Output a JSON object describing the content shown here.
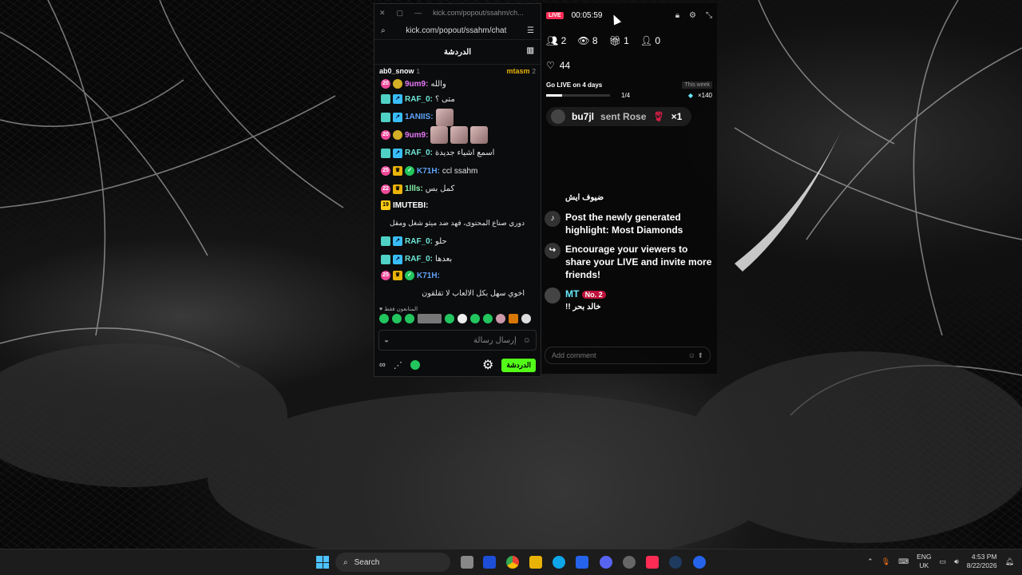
{
  "chat_window": {
    "url_title": "kick.com/popout/ssahm/ch...",
    "url": "kick.com/popout/ssahm/chat",
    "header": "الدردشة",
    "pinned": [
      {
        "name": "ab0_snow",
        "count": "1"
      },
      {
        "name": "mtasm",
        "count": "2"
      }
    ],
    "messages": [
      {
        "user": "9um9:",
        "text": "والله",
        "color": "pink"
      },
      {
        "user": "RAF_0:",
        "text": "متى ؟",
        "color": "teal"
      },
      {
        "user": "1ANIIS:",
        "text": "",
        "color": "blue"
      },
      {
        "user": "9um9:",
        "text": "",
        "color": "pink"
      },
      {
        "user": "RAF_0:",
        "text": "اسمع اشياء جديدة",
        "color": "teal"
      },
      {
        "user": "K71H:",
        "text": "ccl ssahm",
        "color": "blue"
      },
      {
        "user": "1llls:",
        "text": "كمل بس",
        "color": "green"
      },
      {
        "user": "IMUTEBI:",
        "text": "دوري صناع المحتوى، فهد ضد ميثو شغل ومقل",
        "color": "white"
      },
      {
        "user": "RAF_0:",
        "text": "حلو",
        "color": "teal"
      },
      {
        "user": "RAF_0:",
        "text": "بعدها",
        "color": "teal"
      },
      {
        "user": "K71H:",
        "text": "اخوي سهل بكل الالعاب لا تقلقون",
        "color": "blue"
      }
    ],
    "emote_label": "المتابعون فقط",
    "send_placeholder": "إرسال رسالة",
    "chat_button": "الدردشة"
  },
  "live_panel": {
    "live_tag": "LIVE",
    "timer": "00:05:59",
    "stats": {
      "members": "2",
      "viewers": "8",
      "gifts": "1",
      "followers": "0"
    },
    "likes": "44",
    "go_live": "Go LIVE on 4 days",
    "this_week": "This week",
    "progress_text": "1/4",
    "progress_value": 0.25,
    "diamonds": "×140",
    "gift_user": "bu7jl",
    "gift_text": "sent Rose",
    "gift_count": "×1",
    "feed": [
      {
        "text": "ضيوف ايش"
      },
      {
        "text": "Post the newly generated highlight: Most Diamonds"
      },
      {
        "text": "Encourage your viewers to share your LIVE and invite more friends!"
      }
    ],
    "mt_user": "MT",
    "mt_badge": "No. 2",
    "mt_text": "خالد بحر !!",
    "comment_placeholder": "Add comment"
  },
  "taskbar": {
    "search_label": "Search",
    "lang_top": "ENG",
    "lang_bottom": "UK",
    "time": "4:53 PM",
    "date": "8/22/2026"
  }
}
